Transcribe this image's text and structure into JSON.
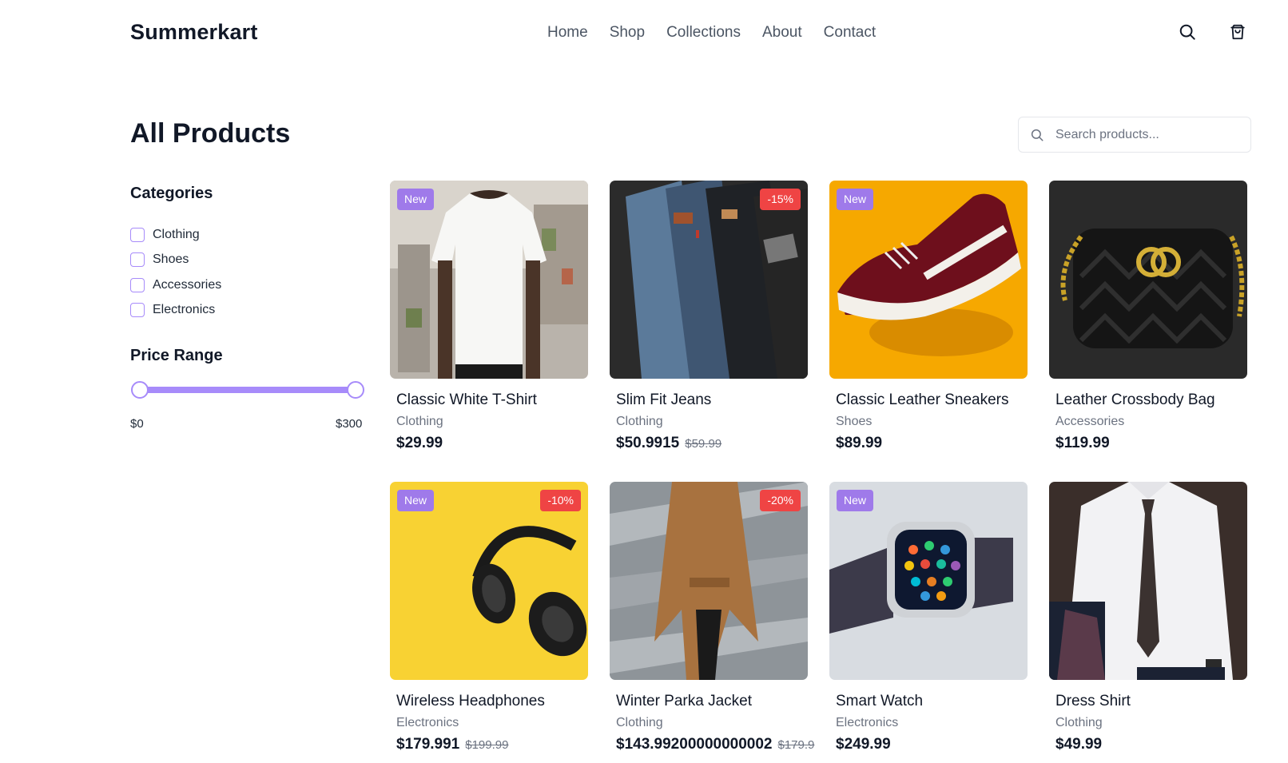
{
  "header": {
    "logo": "Summerkart",
    "nav": [
      "Home",
      "Shop",
      "Collections",
      "About",
      "Contact"
    ],
    "icons": [
      "search-icon",
      "cart-icon"
    ]
  },
  "page": {
    "title": "All Products",
    "search_placeholder": "Search products..."
  },
  "filters": {
    "categories_heading": "Categories",
    "categories": [
      "Clothing",
      "Shoes",
      "Accessories",
      "Electronics"
    ],
    "price_heading": "Price Range",
    "price_min": "$0",
    "price_max": "$300",
    "range_low_fraction": 0,
    "range_high_fraction": 1
  },
  "products": [
    {
      "name": "Classic White T-Shirt",
      "category": "Clothing",
      "price": "$29.99",
      "old_price": "",
      "badge_new": "New",
      "badge_discount": ""
    },
    {
      "name": "Slim Fit Jeans",
      "category": "Clothing",
      "price": "$50.9915",
      "old_price": "$59.99",
      "badge_new": "",
      "badge_discount": "-15%"
    },
    {
      "name": "Classic Leather Sneakers",
      "category": "Shoes",
      "price": "$89.99",
      "old_price": "",
      "badge_new": "New",
      "badge_discount": ""
    },
    {
      "name": "Leather Crossbody Bag",
      "category": "Accessories",
      "price": "$119.99",
      "old_price": "",
      "badge_new": "",
      "badge_discount": ""
    },
    {
      "name": "Wireless Headphones",
      "category": "Electronics",
      "price": "$179.991",
      "old_price": "$199.99",
      "badge_new": "New",
      "badge_discount": "-10%"
    },
    {
      "name": "Winter Parka Jacket",
      "category": "Clothing",
      "price": "$143.99200000000002",
      "old_price": "$179.9",
      "badge_new": "",
      "badge_discount": "-20%"
    },
    {
      "name": "Smart Watch",
      "category": "Electronics",
      "price": "$249.99",
      "old_price": "",
      "badge_new": "New",
      "badge_discount": ""
    },
    {
      "name": "Dress Shirt",
      "category": "Clothing",
      "price": "$49.99",
      "old_price": "",
      "badge_new": "",
      "badge_discount": ""
    }
  ],
  "colors": {
    "accent": "#a78bfa",
    "badge_new": "#9f7aea",
    "badge_discount": "#ef4444",
    "text": "#111827",
    "muted": "#6b7280"
  }
}
